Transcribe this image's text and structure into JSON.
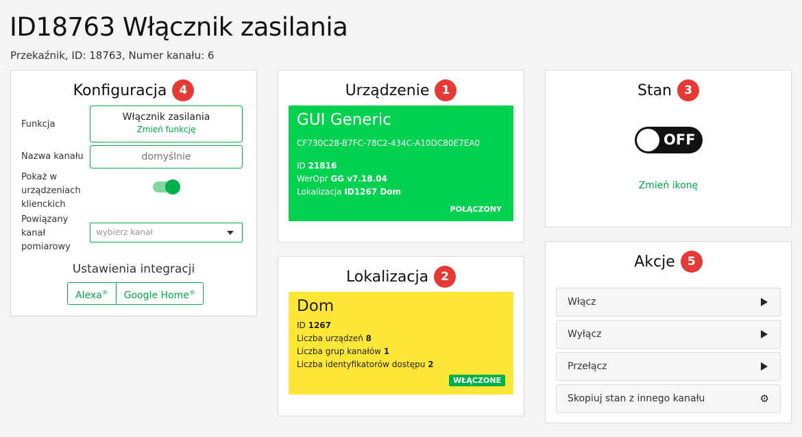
{
  "header": {
    "title": "ID18763 Włącznik zasilania",
    "subtitle": "Przekaźnik, ID: 18763, Numer kanału: 6"
  },
  "config": {
    "title": "Konfiguracja",
    "badge": "4",
    "function_label": "Funkcja",
    "function_value": "Włącznik zasilania",
    "function_change": "Zmień funkcję",
    "name_label": "Nazwa kanału",
    "name_placeholder": "domyślnie",
    "show_label_1": "Pokaż w",
    "show_label_2": "urządzeniach",
    "show_label_3": "klienckich",
    "show_enabled": true,
    "meter_label_1": "Powiązany",
    "meter_label_2": "kanał",
    "meter_label_3": "pomiarowy",
    "meter_placeholder": "wybierz kanał",
    "integrations_title": "Ustawienia integracji",
    "integration_alexa": "Alexa",
    "integration_google": "Google Home",
    "registered_mark": "®"
  },
  "device": {
    "title": "Urządzenie",
    "badge": "1",
    "name": "GUI Generic",
    "guid": "CF730C28-B7FC-78C2-434C-A10DC80E7EA0",
    "id_label": "ID",
    "id_value": "21816",
    "fw_label": "WerOpr",
    "fw_value": "GG v7.18.04",
    "loc_label": "Lokalizacja",
    "loc_value": "ID1267 Dom",
    "status": "POŁĄCZONY",
    "color": "#00d14f"
  },
  "location": {
    "title": "Lokalizacja",
    "badge": "2",
    "name": "Dom",
    "id_label": "ID",
    "id_value": "1267",
    "devices_label": "Liczba urządzeń",
    "devices_value": "8",
    "groups_label": "Liczba grup kanałów",
    "groups_value": "1",
    "access_label": "Liczba identyfikatorów dostępu",
    "access_value": "2",
    "status": "WŁĄCZONE",
    "color": "#ffe737"
  },
  "state": {
    "title": "Stan",
    "badge": "3",
    "toggle_label": "OFF",
    "change_icon": "Zmień ikonę"
  },
  "actions": {
    "title": "Akcje",
    "badge": "5",
    "items": [
      {
        "label": "Włącz",
        "icon": "play-icon"
      },
      {
        "label": "Wyłącz",
        "icon": "play-icon"
      },
      {
        "label": "Przełącz",
        "icon": "play-icon"
      },
      {
        "label": "Skopiuj stan z innego kanału",
        "icon": "gear-icon"
      }
    ]
  },
  "colors": {
    "accent": "#00b14a",
    "badge": "#e53935"
  }
}
